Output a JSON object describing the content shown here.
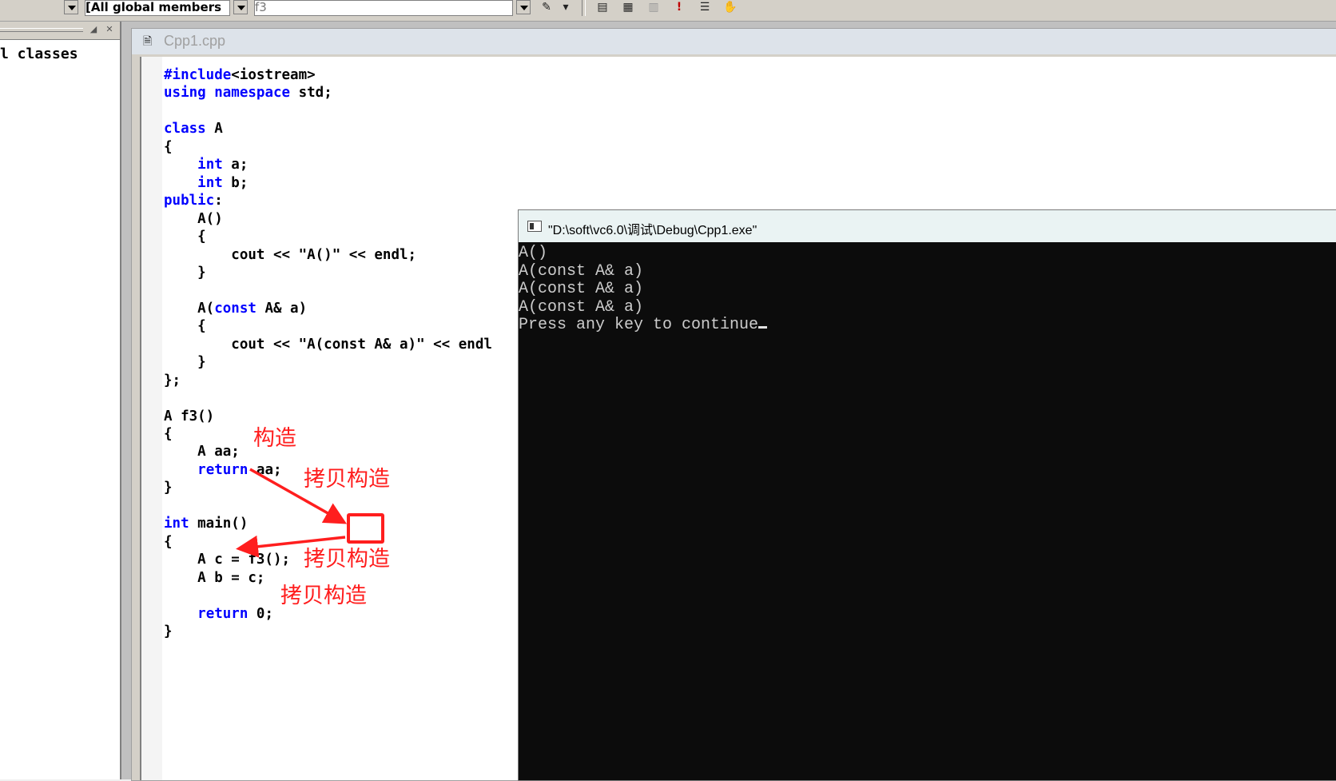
{
  "toolbar": {
    "scope_dropdown": "[All global members",
    "function_dropdown": "f3",
    "icons": [
      "wizard-icon",
      "dropdown-arrow-icon",
      "compile-icon",
      "build-icon",
      "stop-build-icon",
      "execute-icon",
      "breakpoint-icon",
      "go-icon"
    ]
  },
  "left_panel": {
    "tree_label": "l classes"
  },
  "editor": {
    "tab_title": "Cpp1.cpp",
    "lines": [
      {
        "parts": [
          {
            "t": "#include",
            "k": true
          },
          {
            "t": "<iostream>",
            "k": false
          }
        ]
      },
      {
        "parts": [
          {
            "t": "using",
            "k": true
          },
          {
            "t": " ",
            "k": false
          },
          {
            "t": "namespace",
            "k": true
          },
          {
            "t": " std;",
            "k": false
          }
        ]
      },
      {
        "parts": []
      },
      {
        "parts": [
          {
            "t": "class",
            "k": true
          },
          {
            "t": " A",
            "k": false
          }
        ]
      },
      {
        "parts": [
          {
            "t": "{",
            "k": false
          }
        ]
      },
      {
        "parts": [
          {
            "t": "    ",
            "k": false
          },
          {
            "t": "int",
            "k": true
          },
          {
            "t": " a;",
            "k": false
          }
        ]
      },
      {
        "parts": [
          {
            "t": "    ",
            "k": false
          },
          {
            "t": "int",
            "k": true
          },
          {
            "t": " b;",
            "k": false
          }
        ]
      },
      {
        "parts": [
          {
            "t": "public",
            "k": true
          },
          {
            "t": ":",
            "k": false
          }
        ]
      },
      {
        "parts": [
          {
            "t": "    A()",
            "k": false
          }
        ]
      },
      {
        "parts": [
          {
            "t": "    {",
            "k": false
          }
        ]
      },
      {
        "parts": [
          {
            "t": "        cout << \"A()\" << endl;",
            "k": false
          }
        ]
      },
      {
        "parts": [
          {
            "t": "    }",
            "k": false
          }
        ]
      },
      {
        "parts": []
      },
      {
        "parts": [
          {
            "t": "    A(",
            "k": false
          },
          {
            "t": "const",
            "k": true
          },
          {
            "t": " A& a)",
            "k": false
          }
        ]
      },
      {
        "parts": [
          {
            "t": "    {",
            "k": false
          }
        ]
      },
      {
        "parts": [
          {
            "t": "        cout << \"A(const A& a)\" << endl",
            "k": false
          }
        ]
      },
      {
        "parts": [
          {
            "t": "    }",
            "k": false
          }
        ]
      },
      {
        "parts": [
          {
            "t": "};",
            "k": false
          }
        ]
      },
      {
        "parts": []
      },
      {
        "parts": [
          {
            "t": "A f3()",
            "k": false
          }
        ]
      },
      {
        "parts": [
          {
            "t": "{",
            "k": false
          }
        ]
      },
      {
        "parts": [
          {
            "t": "    A aa;",
            "k": false
          }
        ]
      },
      {
        "parts": [
          {
            "t": "    ",
            "k": false
          },
          {
            "t": "return",
            "k": true
          },
          {
            "t": " aa;",
            "k": false
          }
        ]
      },
      {
        "parts": [
          {
            "t": "}",
            "k": false
          }
        ]
      },
      {
        "parts": []
      },
      {
        "parts": [
          {
            "t": "int",
            "k": true
          },
          {
            "t": " main()",
            "k": false
          }
        ]
      },
      {
        "parts": [
          {
            "t": "{",
            "k": false
          }
        ]
      },
      {
        "parts": [
          {
            "t": "    A c = f3();",
            "k": false
          }
        ]
      },
      {
        "parts": [
          {
            "t": "    A b = c;",
            "k": false
          }
        ]
      },
      {
        "parts": []
      },
      {
        "parts": [
          {
            "t": "    ",
            "k": false
          },
          {
            "t": "return",
            "k": true
          },
          {
            "t": " 0;",
            "k": false
          }
        ]
      },
      {
        "parts": [
          {
            "t": "}",
            "k": false
          }
        ]
      }
    ]
  },
  "console": {
    "title": "\"D:\\soft\\vc6.0\\调试\\Debug\\Cpp1.exe\"",
    "lines": [
      "A()",
      "A(const A& a)",
      "A(const A& a)",
      "A(const A& a)",
      "Press any key to continue"
    ]
  },
  "annotations": {
    "construct": "构造",
    "copy1": "拷贝构造",
    "copy2": "拷贝构造",
    "copy3": "拷贝构造",
    "color": "#ff1e1e"
  },
  "colors": {
    "keyword": "#0000ff",
    "console_bg": "#0c0c0c",
    "console_text": "#cccccc"
  }
}
